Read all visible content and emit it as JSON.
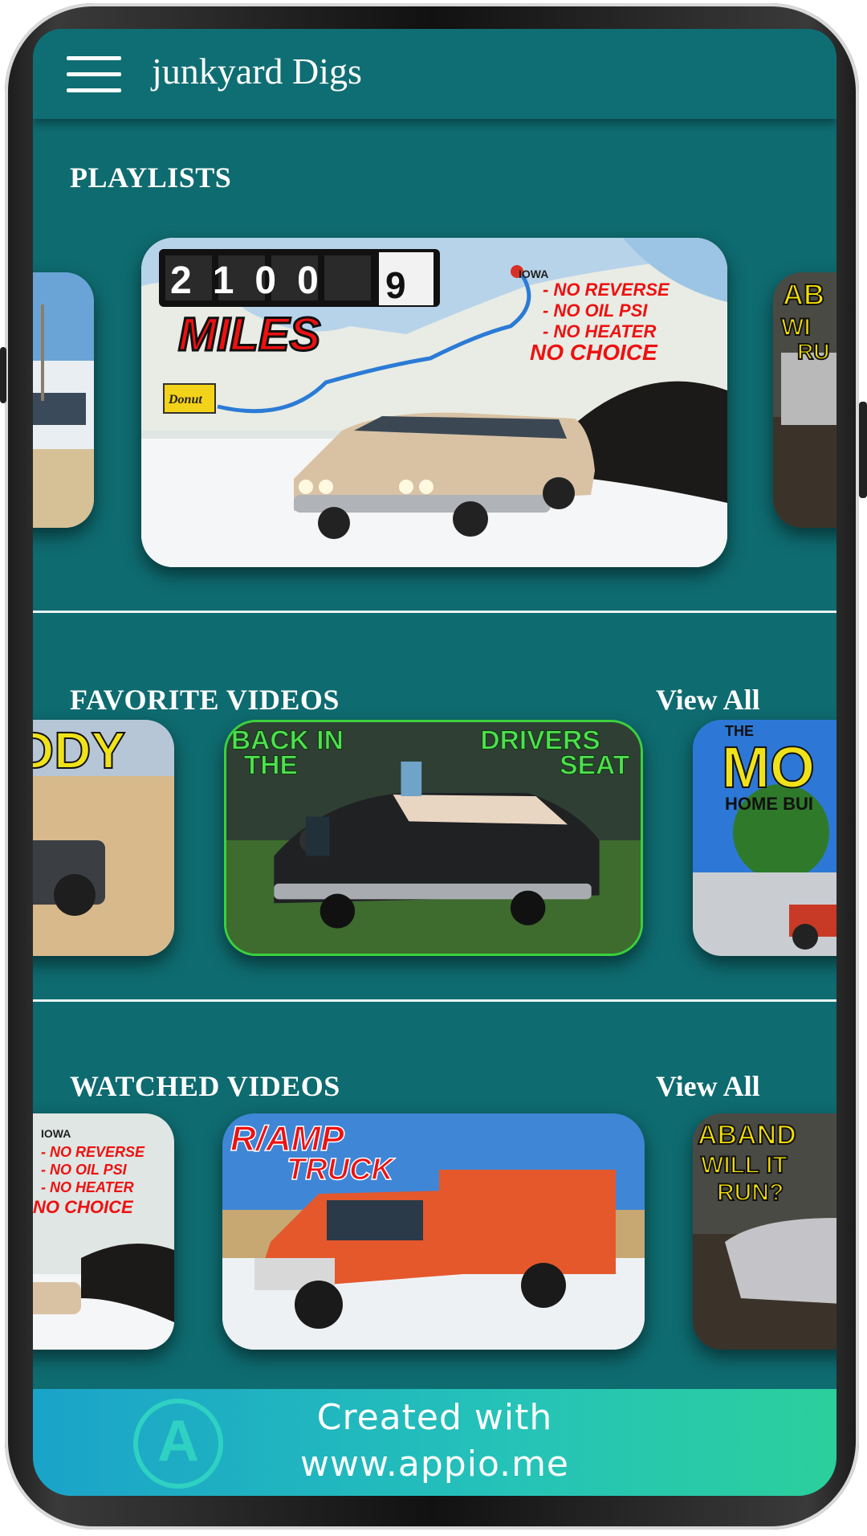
{
  "app": {
    "title": "junkyard Digs"
  },
  "sections": {
    "playlists": {
      "title": "PLAYLISTS"
    },
    "favorites": {
      "title": "FAVORITE VIDEOS",
      "view_all": "View All"
    },
    "watched": {
      "title": "WATCHED VIDEOS",
      "view_all": "View All"
    }
  },
  "thumbnails": {
    "playlist_main": {
      "counter": "2100",
      "miles": "MILES",
      "line1": "- NO REVERSE",
      "line2": "- NO OIL PSI",
      "line3": "- NO HEATER",
      "line4": "NO CHOICE",
      "sign": "Donut",
      "map_label": "IOWA"
    },
    "playlist_right": {
      "line1": "AB",
      "line2": "WI",
      "line3": "RU"
    },
    "fav_left": {
      "text": "DDY"
    },
    "fav_main": {
      "left1": "BACK IN",
      "left2": "THE",
      "right1": "DRIVERS",
      "right2": "SEAT"
    },
    "fav_right": {
      "small": "THE",
      "big": "MO",
      "sub": "HOME BUI"
    },
    "watched_left": {
      "label": "IOWA",
      "line1": "- NO REVERSE",
      "line2": "- NO OIL PSI",
      "line3": "- NO HEATER",
      "line4": "NO CHOICE"
    },
    "watched_main": {
      "brand1": "R/AMP",
      "brand2": "TRUCK"
    },
    "watched_right": {
      "line1": "ABAND",
      "line2": "WILL IT",
      "line3": "RUN?"
    }
  },
  "footer": {
    "line1": "Created with",
    "line2": "www.appio.me"
  },
  "colors": {
    "background": "#0e6b70",
    "text": "#ffffff",
    "footer": "#25c3b8"
  }
}
